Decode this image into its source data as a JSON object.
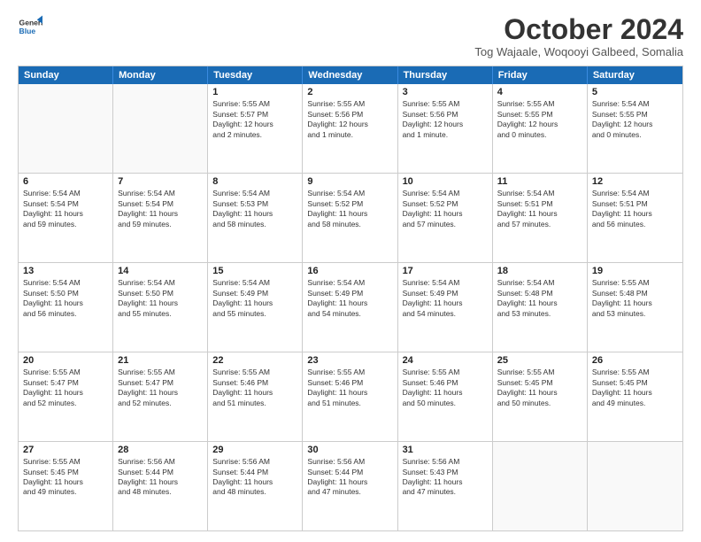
{
  "logo": {
    "line1": "General",
    "line2": "Blue"
  },
  "title": "October 2024",
  "subtitle": "Tog Wajaale, Woqooyi Galbeed, Somalia",
  "header_days": [
    "Sunday",
    "Monday",
    "Tuesday",
    "Wednesday",
    "Thursday",
    "Friday",
    "Saturday"
  ],
  "weeks": [
    [
      {
        "day": "",
        "text": ""
      },
      {
        "day": "",
        "text": ""
      },
      {
        "day": "1",
        "text": "Sunrise: 5:55 AM\nSunset: 5:57 PM\nDaylight: 12 hours\nand 2 minutes."
      },
      {
        "day": "2",
        "text": "Sunrise: 5:55 AM\nSunset: 5:56 PM\nDaylight: 12 hours\nand 1 minute."
      },
      {
        "day": "3",
        "text": "Sunrise: 5:55 AM\nSunset: 5:56 PM\nDaylight: 12 hours\nand 1 minute."
      },
      {
        "day": "4",
        "text": "Sunrise: 5:55 AM\nSunset: 5:55 PM\nDaylight: 12 hours\nand 0 minutes."
      },
      {
        "day": "5",
        "text": "Sunrise: 5:54 AM\nSunset: 5:55 PM\nDaylight: 12 hours\nand 0 minutes."
      }
    ],
    [
      {
        "day": "6",
        "text": "Sunrise: 5:54 AM\nSunset: 5:54 PM\nDaylight: 11 hours\nand 59 minutes."
      },
      {
        "day": "7",
        "text": "Sunrise: 5:54 AM\nSunset: 5:54 PM\nDaylight: 11 hours\nand 59 minutes."
      },
      {
        "day": "8",
        "text": "Sunrise: 5:54 AM\nSunset: 5:53 PM\nDaylight: 11 hours\nand 58 minutes."
      },
      {
        "day": "9",
        "text": "Sunrise: 5:54 AM\nSunset: 5:52 PM\nDaylight: 11 hours\nand 58 minutes."
      },
      {
        "day": "10",
        "text": "Sunrise: 5:54 AM\nSunset: 5:52 PM\nDaylight: 11 hours\nand 57 minutes."
      },
      {
        "day": "11",
        "text": "Sunrise: 5:54 AM\nSunset: 5:51 PM\nDaylight: 11 hours\nand 57 minutes."
      },
      {
        "day": "12",
        "text": "Sunrise: 5:54 AM\nSunset: 5:51 PM\nDaylight: 11 hours\nand 56 minutes."
      }
    ],
    [
      {
        "day": "13",
        "text": "Sunrise: 5:54 AM\nSunset: 5:50 PM\nDaylight: 11 hours\nand 56 minutes."
      },
      {
        "day": "14",
        "text": "Sunrise: 5:54 AM\nSunset: 5:50 PM\nDaylight: 11 hours\nand 55 minutes."
      },
      {
        "day": "15",
        "text": "Sunrise: 5:54 AM\nSunset: 5:49 PM\nDaylight: 11 hours\nand 55 minutes."
      },
      {
        "day": "16",
        "text": "Sunrise: 5:54 AM\nSunset: 5:49 PM\nDaylight: 11 hours\nand 54 minutes."
      },
      {
        "day": "17",
        "text": "Sunrise: 5:54 AM\nSunset: 5:49 PM\nDaylight: 11 hours\nand 54 minutes."
      },
      {
        "day": "18",
        "text": "Sunrise: 5:54 AM\nSunset: 5:48 PM\nDaylight: 11 hours\nand 53 minutes."
      },
      {
        "day": "19",
        "text": "Sunrise: 5:55 AM\nSunset: 5:48 PM\nDaylight: 11 hours\nand 53 minutes."
      }
    ],
    [
      {
        "day": "20",
        "text": "Sunrise: 5:55 AM\nSunset: 5:47 PM\nDaylight: 11 hours\nand 52 minutes."
      },
      {
        "day": "21",
        "text": "Sunrise: 5:55 AM\nSunset: 5:47 PM\nDaylight: 11 hours\nand 52 minutes."
      },
      {
        "day": "22",
        "text": "Sunrise: 5:55 AM\nSunset: 5:46 PM\nDaylight: 11 hours\nand 51 minutes."
      },
      {
        "day": "23",
        "text": "Sunrise: 5:55 AM\nSunset: 5:46 PM\nDaylight: 11 hours\nand 51 minutes."
      },
      {
        "day": "24",
        "text": "Sunrise: 5:55 AM\nSunset: 5:46 PM\nDaylight: 11 hours\nand 50 minutes."
      },
      {
        "day": "25",
        "text": "Sunrise: 5:55 AM\nSunset: 5:45 PM\nDaylight: 11 hours\nand 50 minutes."
      },
      {
        "day": "26",
        "text": "Sunrise: 5:55 AM\nSunset: 5:45 PM\nDaylight: 11 hours\nand 49 minutes."
      }
    ],
    [
      {
        "day": "27",
        "text": "Sunrise: 5:55 AM\nSunset: 5:45 PM\nDaylight: 11 hours\nand 49 minutes."
      },
      {
        "day": "28",
        "text": "Sunrise: 5:56 AM\nSunset: 5:44 PM\nDaylight: 11 hours\nand 48 minutes."
      },
      {
        "day": "29",
        "text": "Sunrise: 5:56 AM\nSunset: 5:44 PM\nDaylight: 11 hours\nand 48 minutes."
      },
      {
        "day": "30",
        "text": "Sunrise: 5:56 AM\nSunset: 5:44 PM\nDaylight: 11 hours\nand 47 minutes."
      },
      {
        "day": "31",
        "text": "Sunrise: 5:56 AM\nSunset: 5:43 PM\nDaylight: 11 hours\nand 47 minutes."
      },
      {
        "day": "",
        "text": ""
      },
      {
        "day": "",
        "text": ""
      }
    ]
  ]
}
